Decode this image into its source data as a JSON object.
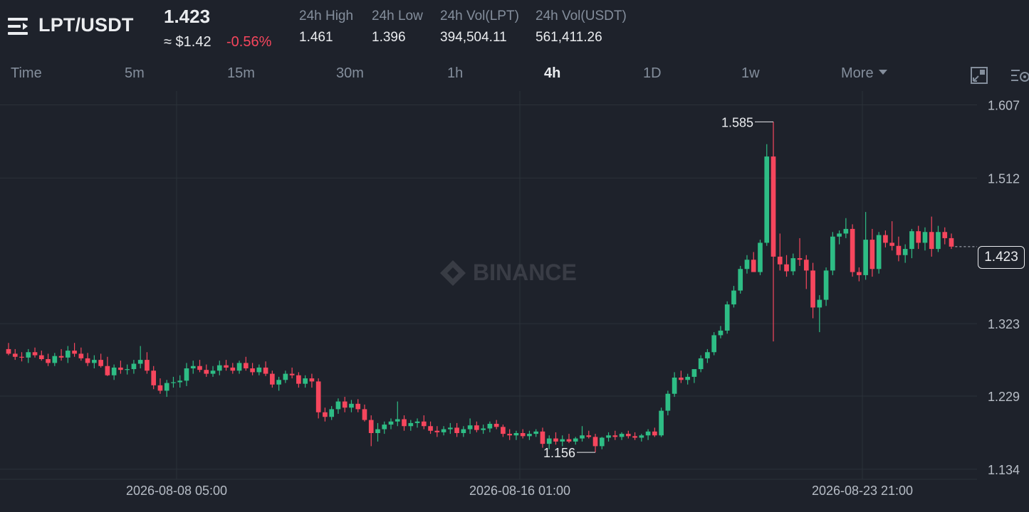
{
  "header": {
    "pair": "LPT/USDT",
    "last_price": "1.423",
    "usd_price": "≈ $1.42",
    "change": "-0.56%",
    "stats": [
      {
        "label": "24h High",
        "value": "1.461"
      },
      {
        "label": "24h Low",
        "value": "1.396"
      },
      {
        "label": "24h Vol(LPT)",
        "value": "394,504.11"
      },
      {
        "label": "24h Vol(USDT)",
        "value": "561,411.26"
      }
    ]
  },
  "intervals": {
    "items": [
      "Time",
      "5m",
      "15m",
      "30m",
      "1h",
      "4h",
      "1D",
      "1w"
    ],
    "active": "4h",
    "more_label": "More"
  },
  "icons": {
    "menu": "menu-icon",
    "depth": "chart-depth-icon",
    "settings": "chart-settings-icon"
  },
  "chart_data": {
    "type": "candlestick",
    "interval": "4h",
    "y_axis_labels": [
      "1.607",
      "1.512",
      "1.323",
      "1.229",
      "1.134"
    ],
    "x_axis_labels": [
      "2026-08-08 05:00",
      "2026-08-16 01:00",
      "2026-08-23 21:00"
    ],
    "ylim": [
      1.121,
      1.625
    ],
    "grid": true,
    "watermark": "BINANCE",
    "annotations": {
      "high": "1.585",
      "low": "1.156"
    },
    "last_price": 1.423,
    "last_price_label": "1.423",
    "colors": {
      "up": "#2ebd85",
      "down": "#f6465d",
      "grid": "#2b3139",
      "axis_text": "#b7bdc6"
    },
    "candles": [
      [
        1.29,
        1.298,
        1.282,
        1.284
      ],
      [
        1.284,
        1.29,
        1.276,
        1.28
      ],
      [
        1.28,
        1.286,
        1.274,
        1.279
      ],
      [
        1.279,
        1.29,
        1.272,
        1.286
      ],
      [
        1.286,
        1.292,
        1.279,
        1.282
      ],
      [
        1.282,
        1.288,
        1.275,
        1.277
      ],
      [
        1.277,
        1.284,
        1.268,
        1.272
      ],
      [
        1.272,
        1.285,
        1.268,
        1.281
      ],
      [
        1.281,
        1.29,
        1.275,
        1.279
      ],
      [
        1.279,
        1.294,
        1.272,
        1.288
      ],
      [
        1.288,
        1.298,
        1.28,
        1.284
      ],
      [
        1.284,
        1.292,
        1.275,
        1.278
      ],
      [
        1.278,
        1.285,
        1.268,
        1.272
      ],
      [
        1.272,
        1.282,
        1.265,
        1.276
      ],
      [
        1.276,
        1.284,
        1.266,
        1.268
      ],
      [
        1.268,
        1.28,
        1.255,
        1.256
      ],
      [
        1.256,
        1.27,
        1.25,
        1.266
      ],
      [
        1.266,
        1.275,
        1.258,
        1.263
      ],
      [
        1.263,
        1.27,
        1.257,
        1.264
      ],
      [
        1.264,
        1.276,
        1.258,
        1.271
      ],
      [
        1.271,
        1.294,
        1.265,
        1.276
      ],
      [
        1.276,
        1.286,
        1.258,
        1.262
      ],
      [
        1.262,
        1.268,
        1.238,
        1.243
      ],
      [
        1.243,
        1.252,
        1.232,
        1.236
      ],
      [
        1.236,
        1.25,
        1.228,
        1.246
      ],
      [
        1.246,
        1.254,
        1.24,
        1.247
      ],
      [
        1.247,
        1.256,
        1.24,
        1.249
      ],
      [
        1.249,
        1.272,
        1.242,
        1.265
      ],
      [
        1.265,
        1.275,
        1.258,
        1.268
      ],
      [
        1.268,
        1.276,
        1.26,
        1.263
      ],
      [
        1.263,
        1.27,
        1.254,
        1.258
      ],
      [
        1.258,
        1.268,
        1.254,
        1.262
      ],
      [
        1.262,
        1.275,
        1.256,
        1.269
      ],
      [
        1.269,
        1.276,
        1.262,
        1.266
      ],
      [
        1.266,
        1.272,
        1.258,
        1.262
      ],
      [
        1.262,
        1.275,
        1.258,
        1.272
      ],
      [
        1.272,
        1.28,
        1.262,
        1.265
      ],
      [
        1.265,
        1.272,
        1.256,
        1.26
      ],
      [
        1.26,
        1.27,
        1.256,
        1.266
      ],
      [
        1.266,
        1.274,
        1.255,
        1.258
      ],
      [
        1.258,
        1.262,
        1.24,
        1.244
      ],
      [
        1.244,
        1.254,
        1.236,
        1.25
      ],
      [
        1.25,
        1.262,
        1.246,
        1.258
      ],
      [
        1.258,
        1.266,
        1.252,
        1.256
      ],
      [
        1.256,
        1.26,
        1.24,
        1.245
      ],
      [
        1.245,
        1.256,
        1.24,
        1.252
      ],
      [
        1.252,
        1.258,
        1.24,
        1.248
      ],
      [
        1.248,
        1.252,
        1.2,
        1.208
      ],
      [
        1.208,
        1.214,
        1.196,
        1.202
      ],
      [
        1.202,
        1.216,
        1.198,
        1.212
      ],
      [
        1.212,
        1.226,
        1.206,
        1.222
      ],
      [
        1.222,
        1.228,
        1.208,
        1.214
      ],
      [
        1.214,
        1.224,
        1.208,
        1.219
      ],
      [
        1.219,
        1.225,
        1.208,
        1.212
      ],
      [
        1.212,
        1.218,
        1.196,
        1.198
      ],
      [
        1.198,
        1.204,
        1.164,
        1.181
      ],
      [
        1.181,
        1.194,
        1.17,
        1.186
      ],
      [
        1.186,
        1.196,
        1.18,
        1.192
      ],
      [
        1.192,
        1.2,
        1.186,
        1.196
      ],
      [
        1.196,
        1.222,
        1.19,
        1.199
      ],
      [
        1.199,
        1.204,
        1.184,
        1.19
      ],
      [
        1.19,
        1.198,
        1.184,
        1.194
      ],
      [
        1.194,
        1.2,
        1.188,
        1.196
      ],
      [
        1.196,
        1.204,
        1.186,
        1.19
      ],
      [
        1.19,
        1.196,
        1.18,
        1.184
      ],
      [
        1.184,
        1.19,
        1.176,
        1.182
      ],
      [
        1.182,
        1.19,
        1.178,
        1.186
      ],
      [
        1.186,
        1.194,
        1.18,
        1.188
      ],
      [
        1.188,
        1.194,
        1.176,
        1.181
      ],
      [
        1.181,
        1.19,
        1.176,
        1.186
      ],
      [
        1.186,
        1.2,
        1.18,
        1.191
      ],
      [
        1.191,
        1.196,
        1.182,
        1.185
      ],
      [
        1.185,
        1.192,
        1.18,
        1.187
      ],
      [
        1.187,
        1.196,
        1.182,
        1.193
      ],
      [
        1.193,
        1.198,
        1.186,
        1.189
      ],
      [
        1.189,
        1.192,
        1.176,
        1.18
      ],
      [
        1.18,
        1.186,
        1.172,
        1.178
      ],
      [
        1.178,
        1.184,
        1.172,
        1.181
      ],
      [
        1.181,
        1.186,
        1.174,
        1.177
      ],
      [
        1.177,
        1.184,
        1.172,
        1.18
      ],
      [
        1.18,
        1.186,
        1.176,
        1.183
      ],
      [
        1.183,
        1.188,
        1.162,
        1.167
      ],
      [
        1.167,
        1.178,
        1.16,
        1.174
      ],
      [
        1.174,
        1.182,
        1.166,
        1.17
      ],
      [
        1.17,
        1.178,
        1.164,
        1.173
      ],
      [
        1.173,
        1.18,
        1.168,
        1.17
      ],
      [
        1.17,
        1.176,
        1.166,
        1.174
      ],
      [
        1.174,
        1.19,
        1.17,
        1.178
      ],
      [
        1.178,
        1.184,
        1.174,
        1.176
      ],
      [
        1.176,
        1.18,
        1.156,
        1.164
      ],
      [
        1.164,
        1.176,
        1.16,
        1.175
      ],
      [
        1.175,
        1.182,
        1.17,
        1.178
      ],
      [
        1.178,
        1.184,
        1.172,
        1.176
      ],
      [
        1.176,
        1.182,
        1.172,
        1.18
      ],
      [
        1.18,
        1.184,
        1.174,
        1.177
      ],
      [
        1.177,
        1.182,
        1.172,
        1.175
      ],
      [
        1.175,
        1.18,
        1.17,
        1.178
      ],
      [
        1.178,
        1.186,
        1.172,
        1.183
      ],
      [
        1.183,
        1.188,
        1.176,
        1.178
      ],
      [
        1.178,
        1.214,
        1.176,
        1.21
      ],
      [
        1.21,
        1.236,
        1.204,
        1.232
      ],
      [
        1.232,
        1.26,
        1.228,
        1.253
      ],
      [
        1.253,
        1.262,
        1.246,
        1.25
      ],
      [
        1.25,
        1.258,
        1.244,
        1.254
      ],
      [
        1.254,
        1.262,
        1.246,
        1.264
      ],
      [
        1.264,
        1.282,
        1.26,
        1.278
      ],
      [
        1.278,
        1.29,
        1.272,
        1.286
      ],
      [
        1.286,
        1.312,
        1.282,
        1.308
      ],
      [
        1.308,
        1.32,
        1.304,
        1.314
      ],
      [
        1.314,
        1.352,
        1.31,
        1.348
      ],
      [
        1.348,
        1.372,
        1.344,
        1.366
      ],
      [
        1.366,
        1.398,
        1.362,
        1.394
      ],
      [
        1.394,
        1.412,
        1.388,
        1.406
      ],
      [
        1.406,
        1.416,
        1.396,
        1.39
      ],
      [
        1.39,
        1.432,
        1.386,
        1.428
      ],
      [
        1.428,
        1.556,
        1.424,
        1.54
      ],
      [
        1.54,
        1.585,
        1.3,
        1.41
      ],
      [
        1.41,
        1.44,
        1.392,
        1.4
      ],
      [
        1.4,
        1.412,
        1.384,
        1.391
      ],
      [
        1.391,
        1.414,
        1.386,
        1.408
      ],
      [
        1.408,
        1.434,
        1.398,
        1.406
      ],
      [
        1.406,
        1.412,
        1.368,
        1.392
      ],
      [
        1.392,
        1.402,
        1.33,
        1.344
      ],
      [
        1.344,
        1.36,
        1.312,
        1.354
      ],
      [
        1.354,
        1.396,
        1.346,
        1.392
      ],
      [
        1.392,
        1.442,
        1.386,
        1.436
      ],
      [
        1.436,
        1.444,
        1.426,
        1.44
      ],
      [
        1.44,
        1.46,
        1.434,
        1.446
      ],
      [
        1.446,
        1.452,
        1.384,
        1.39
      ],
      [
        1.39,
        1.396,
        1.378,
        1.386
      ],
      [
        1.386,
        1.468,
        1.38,
        1.432
      ],
      [
        1.432,
        1.446,
        1.384,
        1.394
      ],
      [
        1.394,
        1.442,
        1.388,
        1.438
      ],
      [
        1.438,
        1.444,
        1.422,
        1.428
      ],
      [
        1.428,
        1.456,
        1.418,
        1.424
      ],
      [
        1.424,
        1.436,
        1.404,
        1.412
      ],
      [
        1.412,
        1.426,
        1.402,
        1.42
      ],
      [
        1.42,
        1.446,
        1.408,
        1.443
      ],
      [
        1.443,
        1.45,
        1.42,
        1.428
      ],
      [
        1.428,
        1.448,
        1.418,
        1.442
      ],
      [
        1.442,
        1.462,
        1.41,
        1.42
      ],
      [
        1.42,
        1.45,
        1.416,
        1.442
      ],
      [
        1.442,
        1.448,
        1.426,
        1.434
      ],
      [
        1.434,
        1.44,
        1.42,
        1.423
      ]
    ]
  }
}
